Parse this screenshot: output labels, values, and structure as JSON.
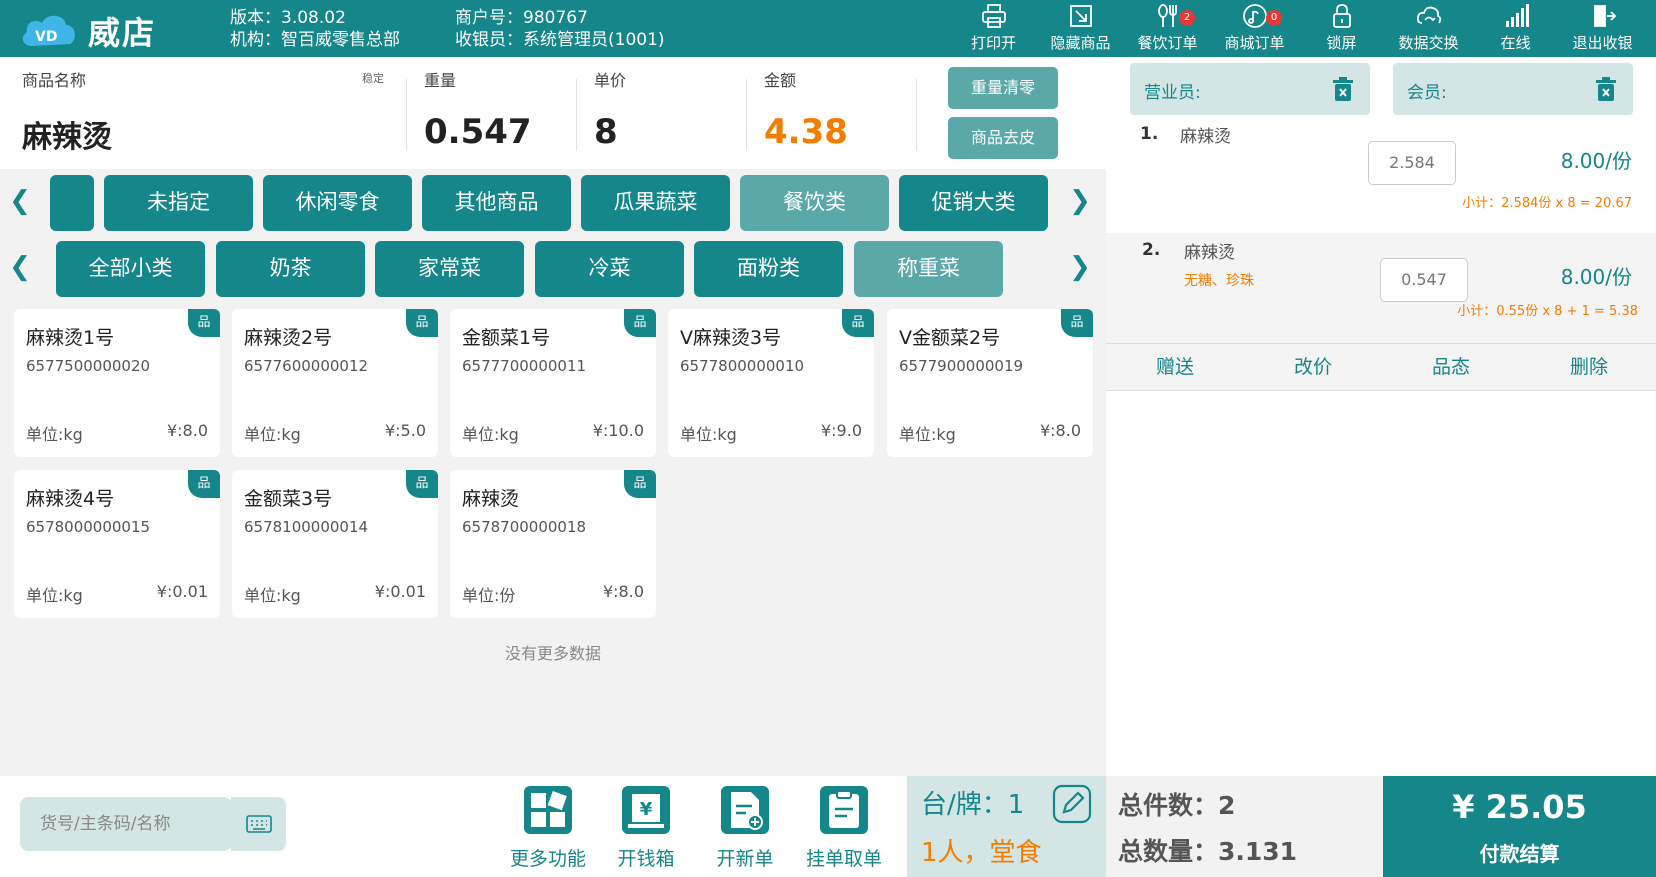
{
  "header": {
    "brand": "威店",
    "version": "版本：3.08.02",
    "org": "机构：智百威零售总部",
    "merchant": "商户号：980767",
    "cashier": "收银员：系统管理员(1001)",
    "buttons": [
      {
        "label": "打印开",
        "icon": "printer-icon"
      },
      {
        "label": "隐藏商品",
        "icon": "hide-icon"
      },
      {
        "label": "餐饮订单",
        "icon": "food-order-icon",
        "badge": "2"
      },
      {
        "label": "商城订单",
        "icon": "mall-order-icon",
        "badge": "0"
      },
      {
        "label": "锁屏",
        "icon": "lock-icon"
      },
      {
        "label": "数据交换",
        "icon": "cloud-sync-icon"
      },
      {
        "label": "在线",
        "icon": "signal-icon"
      },
      {
        "label": "退出收银",
        "icon": "logout-icon"
      }
    ]
  },
  "scale": {
    "name_label": "商品名称",
    "stable": "稳定",
    "name": "麻辣烫",
    "weight_label": "重量",
    "weight": "0.547",
    "price_label": "单价",
    "price": "8",
    "amount_label": "金额",
    "amount": "4.38",
    "btn_zero": "重量清零",
    "btn_tare": "商品去皮"
  },
  "categories": {
    "main": [
      "未指定",
      "休闲零食",
      "其他商品",
      "瓜果蔬菜",
      "餐饮类",
      "促销大类"
    ],
    "sub": [
      "全部小类",
      "奶茶",
      "家常菜",
      "冷菜",
      "面粉类",
      "称重菜"
    ]
  },
  "products": [
    {
      "name": "麻辣烫1号",
      "code": "6577500000020",
      "unit": "单位:kg",
      "price": "¥:8.0",
      "tag": "品"
    },
    {
      "name": "麻辣烫2号",
      "code": "6577600000012",
      "unit": "单位:kg",
      "price": "¥:5.0",
      "tag": "品"
    },
    {
      "name": "金额菜1号",
      "code": "6577700000011",
      "unit": "单位:kg",
      "price": "¥:10.0",
      "tag": "品"
    },
    {
      "name": "V麻辣烫3号",
      "code": "6577800000010",
      "unit": "单位:kg",
      "price": "¥:9.0",
      "tag": "品"
    },
    {
      "name": "V金额菜2号",
      "code": "6577900000019",
      "unit": "单位:kg",
      "price": "¥:8.0",
      "tag": "品"
    },
    {
      "name": "麻辣烫4号",
      "code": "6578000000015",
      "unit": "单位:kg",
      "price": "¥:0.01",
      "tag": "品"
    },
    {
      "name": "金额菜3号",
      "code": "6578100000014",
      "unit": "单位:kg",
      "price": "¥:0.01",
      "tag": "品"
    },
    {
      "name": "麻辣烫",
      "code": "6578700000018",
      "unit": "单位:份",
      "price": "¥:8.0",
      "tag": "品"
    }
  ],
  "no_more": "没有更多数据",
  "bottom": {
    "search_placeholder": "货号/主条码/名称",
    "functions": [
      "更多功能",
      "开钱箱",
      "开新单",
      "挂单取单"
    ],
    "table_label": "台/牌：1",
    "people": "1人，堂食"
  },
  "cart": {
    "salesperson_label": "营业员:",
    "member_label": "会员:",
    "items": [
      {
        "index": "1.",
        "name": "麻辣烫",
        "qty": "2.584",
        "price": "8.00/份",
        "subtotal": "小计：2.584份 x 8 = 20.67"
      },
      {
        "index": "2.",
        "name": "麻辣烫",
        "attrs": "无糖、珍珠",
        "qty": "0.547",
        "price": "8.00/份",
        "subtotal": "小计：0.55份 x 8 + 1 = 5.38"
      }
    ],
    "actions": [
      "赠送",
      "改价",
      "品态",
      "删除"
    ],
    "total_count_label": "总件数：2",
    "total_qty_label": "总数量：3.131",
    "pay_amount": "¥ 25.05",
    "pay_label": "付款结算"
  },
  "colors": {
    "primary": "#15868a",
    "light": "#5aa8a8",
    "pale": "#d3e6e5",
    "orange": "#f57c00",
    "badge": "#e53935"
  }
}
